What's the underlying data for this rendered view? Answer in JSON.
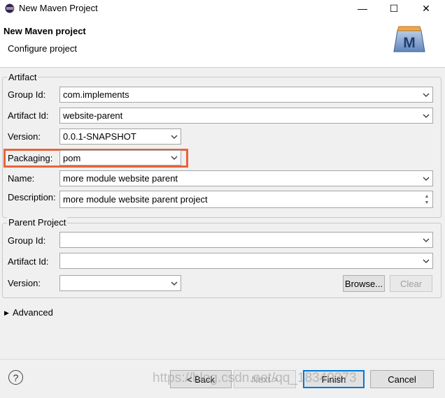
{
  "window": {
    "title": "New Maven Project",
    "minimize": "—",
    "maximize": "☐",
    "close": "✕"
  },
  "header": {
    "title": "New Maven project",
    "subtitle": "Configure project",
    "logo_letter": "M"
  },
  "artifact": {
    "legend": "Artifact",
    "group_id": {
      "label": "Group Id:",
      "value": "com.implements"
    },
    "artifact_id": {
      "label": "Artifact Id:",
      "value": "website-parent"
    },
    "version": {
      "label": "Version:",
      "value": "0.0.1-SNAPSHOT"
    },
    "packaging": {
      "label": "Packaging:",
      "value": "pom"
    },
    "name": {
      "label": "Name:",
      "value": "more module website parent"
    },
    "description": {
      "label": "Description:",
      "value": "more module website parent project"
    }
  },
  "parent": {
    "legend": "Parent Project",
    "group_id": {
      "label": "Group Id:",
      "value": ""
    },
    "artifact_id": {
      "label": "Artifact Id:",
      "value": ""
    },
    "version": {
      "label": "Version:",
      "value": ""
    },
    "browse": "Browse...",
    "clear": "Clear"
  },
  "advanced": {
    "label": "Advanced"
  },
  "footer": {
    "help": "?",
    "back": "< Back",
    "next": "Next >",
    "finish": "Finish",
    "cancel": "Cancel"
  },
  "watermark": "https://blog.csdn.net/qq_18340373",
  "colors": {
    "highlight": "#e8633a",
    "default_button": "#0078d7"
  }
}
